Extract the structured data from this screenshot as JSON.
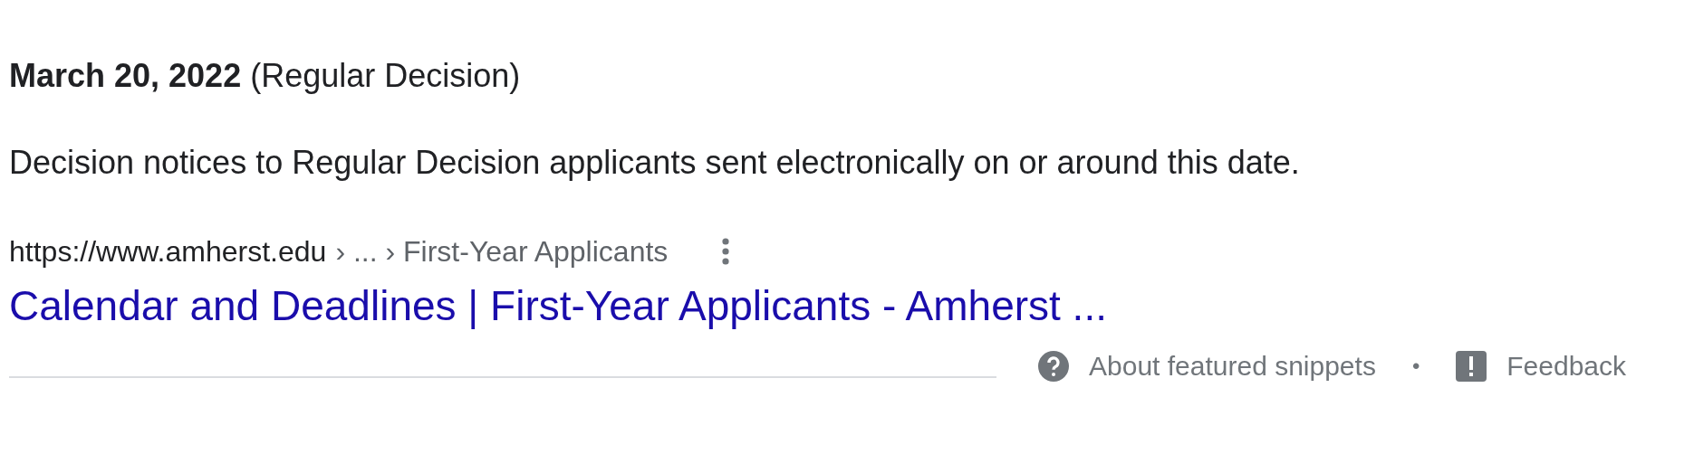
{
  "heading": "**March 20, 2022** (Regular Decision)",
  "snippet": "Decision notices to Regular Decision applicants sent electronically on or around this date.",
  "source": {
    "url": "https://www.amherst.edu",
    "breadcrumb": "› ... › First-Year Applicants"
  },
  "result_title": "Calendar and Deadlines | First-Year Applicants - Amherst ...",
  "footer": {
    "about": "About featured snippets",
    "separator": "•",
    "feedback": "Feedback"
  }
}
